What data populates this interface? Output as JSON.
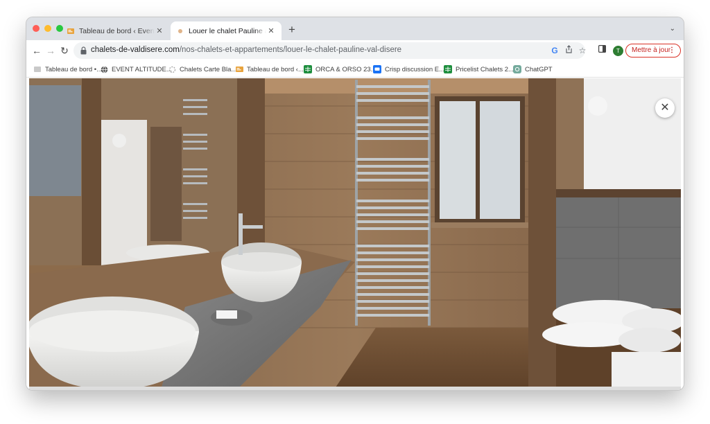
{
  "browser": {
    "tabs": [
      {
        "title": "Tableau de bord ‹ Event Altitude",
        "active": false,
        "favicon": "wordpress-dashboard-icon"
      },
      {
        "title": "Louer le chalet Pauline à Val d’Isère",
        "active": true,
        "favicon": "site-favicon"
      }
    ],
    "url_host": "chalets-de-valdisere.com",
    "url_path": "/nos-chalets-et-appartements/louer-le-chalet-pauline-val-disere",
    "update_label": "Mettre à jour",
    "avatar_letter": "T"
  },
  "bookmarks": [
    {
      "label": "Tableau de bord •...",
      "icon": "wordpress-icon"
    },
    {
      "label": "EVENT ALTITUDE...",
      "icon": "globe-icon"
    },
    {
      "label": "Chalets Carte Bla...",
      "icon": "spinner-icon"
    },
    {
      "label": "Tableau de bord ‹...",
      "icon": "wordpress-icon"
    },
    {
      "label": "ORCA & ORSO 23...",
      "icon": "sheets-icon"
    },
    {
      "label": "Crisp discussion E...",
      "icon": "crisp-icon"
    },
    {
      "label": "Pricelist Chalets 2...",
      "icon": "sheets-icon"
    },
    {
      "label": "ChatGPT",
      "icon": "chatgpt-icon"
    }
  ],
  "lightbox": {
    "image": "bathroom-photo",
    "close_symbol": "✕"
  },
  "colors": {
    "update_accent": "#d93025",
    "avatar": "#2e7d32",
    "wood": "#8a6d52"
  }
}
